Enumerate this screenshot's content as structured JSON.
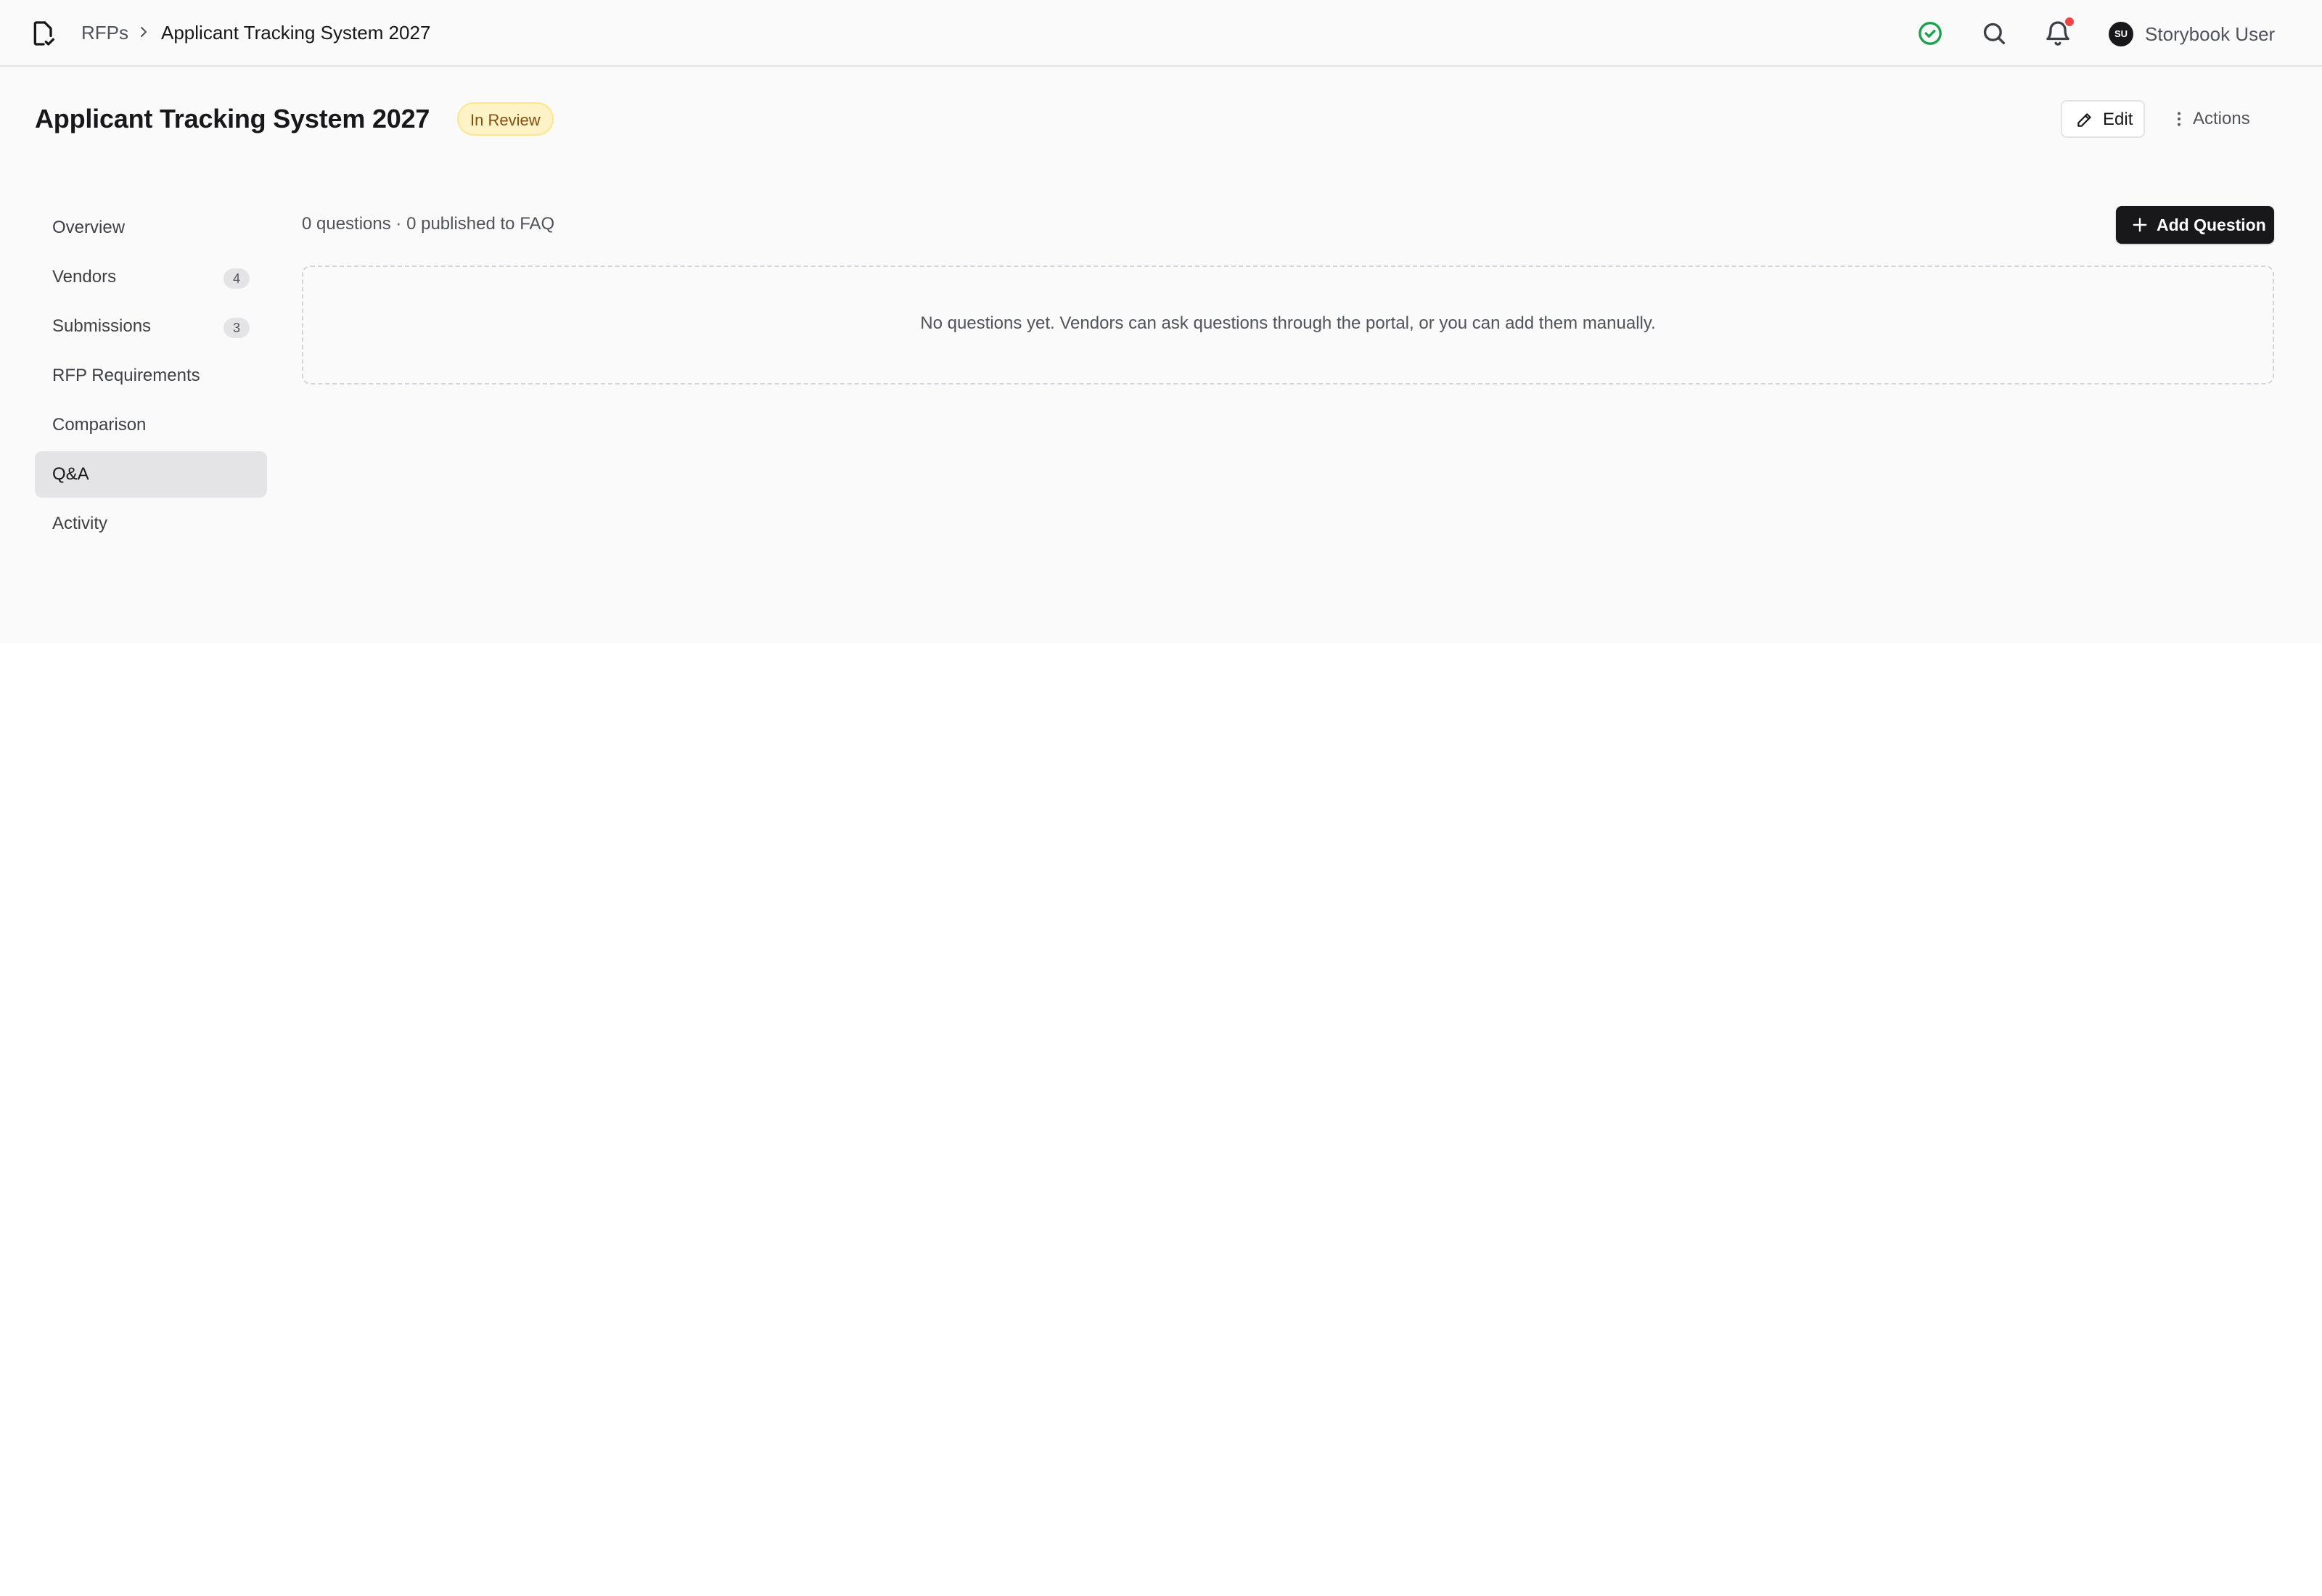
{
  "breadcrumb": {
    "root": "RFPs",
    "current": "Applicant Tracking System 2027"
  },
  "topbar": {
    "icons": [
      "check-circle-icon",
      "search-icon",
      "bell-icon"
    ],
    "user": {
      "initials": "SU",
      "name": "Storybook User"
    }
  },
  "header": {
    "title": "Applicant Tracking System 2027",
    "status": "In Review",
    "edit_label": "Edit",
    "actions_label": "Actions"
  },
  "nav": {
    "items": [
      {
        "label": "Overview",
        "count": null,
        "active": false
      },
      {
        "label": "Vendors",
        "count": "4",
        "active": false
      },
      {
        "label": "Submissions",
        "count": "3",
        "active": false
      },
      {
        "label": "RFP Requirements",
        "count": null,
        "active": false
      },
      {
        "label": "Comparison",
        "count": null,
        "active": false
      },
      {
        "label": "Q&A",
        "count": null,
        "active": true
      },
      {
        "label": "Activity",
        "count": null,
        "active": false
      }
    ]
  },
  "qa": {
    "summary": "0 questions · 0 published to FAQ",
    "add_label": "Add Question",
    "empty_message": "No questions yet. Vendors can ask questions through the portal, or you can add them manually."
  },
  "colors": {
    "accent": "#18181b",
    "status_bg": "#fef3c7",
    "status_text": "#854d0e",
    "success": "#16a34a",
    "notification": "#ef4444"
  }
}
